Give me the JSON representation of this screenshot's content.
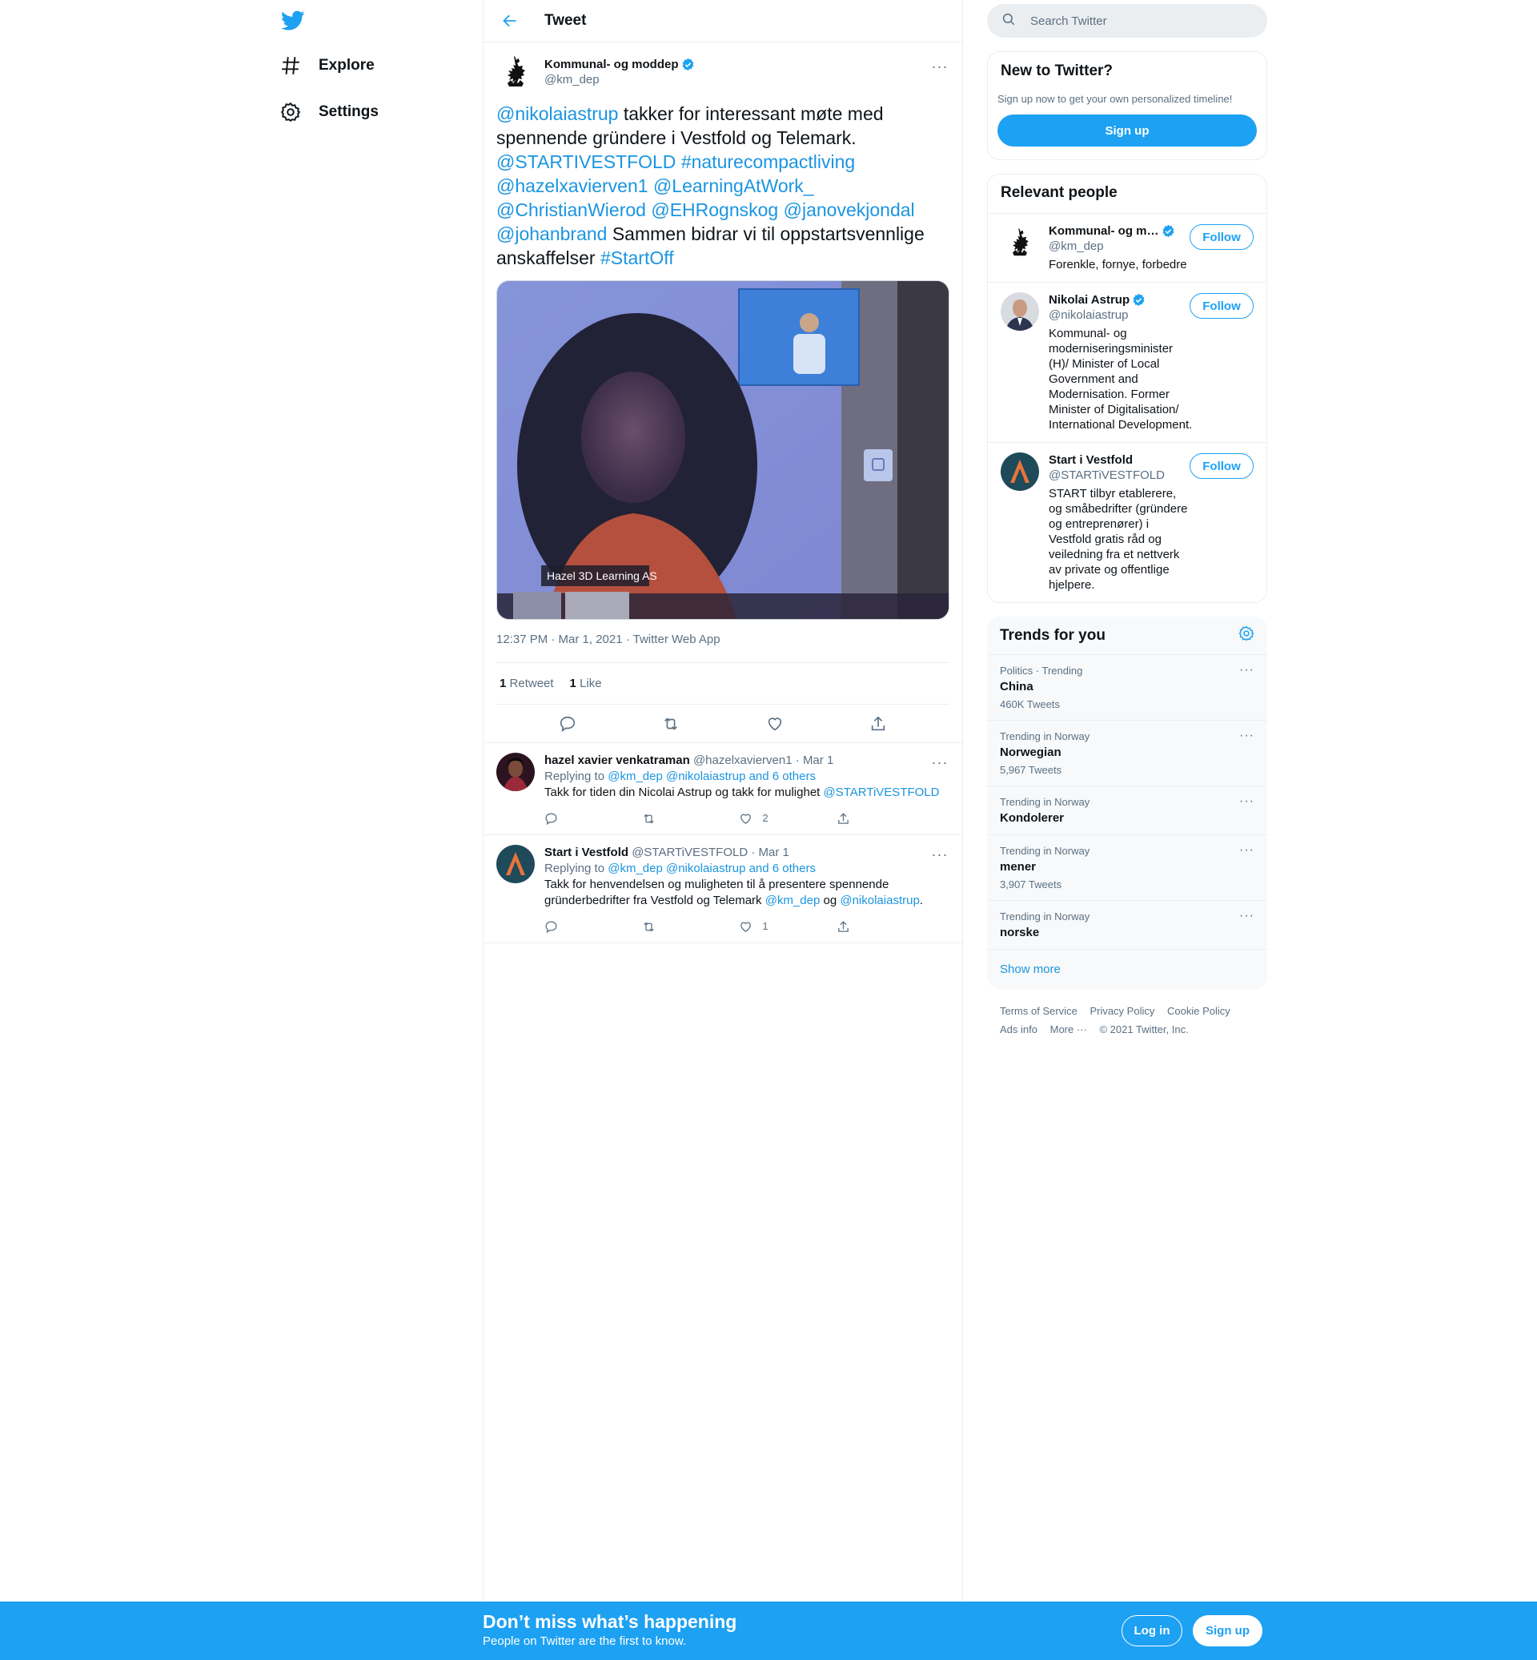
{
  "nav": {
    "explore_label": "Explore",
    "settings_label": "Settings"
  },
  "header": {
    "title": "Tweet"
  },
  "tweet": {
    "display_name": "Kommunal- og moddep",
    "handle": "@km_dep",
    "text_parts": [
      {
        "t": "@nikolaiastrup",
        "link": true
      },
      {
        "t": " takker for interessant møte med spennende gründere i Vestfold og Telemark. ",
        "link": false
      },
      {
        "t": "@STARTIVESTFOLD",
        "link": true
      },
      {
        "t": "  ",
        "link": false
      },
      {
        "t": "#naturecompactliving",
        "link": true
      },
      {
        "t": " ",
        "link": false
      },
      {
        "t": "@hazelxavierven1",
        "link": true
      },
      {
        "t": " ",
        "link": false
      },
      {
        "t": "@LearningAtWork_",
        "link": true
      },
      {
        "t": " ",
        "link": false
      },
      {
        "t": "@ChristianWierod",
        "link": true
      },
      {
        "t": " ",
        "link": false
      },
      {
        "t": "@EHRognskog",
        "link": true
      },
      {
        "t": " ",
        "link": false
      },
      {
        "t": "@janovekjondal",
        "link": true
      },
      {
        "t": " ",
        "link": false
      },
      {
        "t": "@johanbrand",
        "link": true
      },
      {
        "t": " Sammen bidrar vi til oppstartsvennlige anskaffelser ",
        "link": false
      },
      {
        "t": "#StartOff",
        "link": true
      }
    ],
    "media_caption": "Hazel 3D Learning AS",
    "timestamp": "12:37 PM · Mar 1, 2021 · Twitter Web App",
    "retweets_count": "1",
    "retweets_label": "Retweet",
    "likes_count": "1",
    "likes_label": "Like"
  },
  "replies": [
    {
      "name": "hazel xavier venkatraman",
      "handle": "@hazelxavierven1",
      "date": "Mar 1",
      "replying_prefix": "Replying to ",
      "replying_to": "@km_dep @nikolaiastrup and 6 others",
      "text": "Takk for tiden din Nicolai Astrup og takk for mulighet ",
      "text_link": "@STARTiVESTFOLD",
      "likes": "2"
    },
    {
      "name": "Start i Vestfold",
      "handle": "@STARTiVESTFOLD",
      "date": "Mar 1",
      "replying_prefix": "Replying to ",
      "replying_to": "@km_dep @nikolaiastrup and 6 others",
      "text": "Takk for henvendelsen og muligheten til å presentere spennende gründerbedrifter fra Vestfold og Telemark  ",
      "link1": "@km_dep",
      "mid": " og ",
      "link2": "@nikolaiastrup",
      "end": ".",
      "likes": "1"
    }
  ],
  "search": {
    "placeholder": "Search Twitter"
  },
  "new_to_twitter": {
    "title": "New to Twitter?",
    "text": "Sign up now to get your own personalized timeline!",
    "button": "Sign up"
  },
  "relevant_people": {
    "title": "Relevant people",
    "follow_label": "Follow",
    "people": [
      {
        "name": "Kommunal- og m…",
        "handle": "@km_dep",
        "bio": "Forenkle, fornye, forbedre"
      },
      {
        "name": "Nikolai Astrup",
        "handle": "@nikolaiastrup",
        "bio": "Kommunal- og moderniseringsminister (H)/ Minister of Local Government and Modernisation. Former Minister of Digitalisation/ International Development."
      },
      {
        "name": "Start i Vestfold",
        "handle": "@STARTiVESTFOLD",
        "bio": "START tilbyr etablerere, og småbedrifter (gründere og entreprenører) i Vestfold gratis råd og veiledning fra et nettverk av private og offentlige hjelpere."
      }
    ]
  },
  "trends": {
    "title": "Trends for you",
    "items": [
      {
        "context": "Politics · Trending",
        "name": "China",
        "count": "460K Tweets"
      },
      {
        "context": "Trending in Norway",
        "name": "Norwegian",
        "count": "5,967 Tweets"
      },
      {
        "context": "Trending in Norway",
        "name": "Kondolerer",
        "count": ""
      },
      {
        "context": "Trending in Norway",
        "name": "mener",
        "count": "3,907 Tweets"
      },
      {
        "context": "Trending in Norway",
        "name": "norske",
        "count": ""
      }
    ],
    "show_more": "Show more"
  },
  "footer": {
    "terms": "Terms of Service",
    "privacy": "Privacy Policy",
    "cookie": "Cookie Policy",
    "ads": "Ads info",
    "more": "More ···",
    "copyright": "© 2021 Twitter, Inc."
  },
  "bottom_bar": {
    "title": "Don’t miss what’s happening",
    "subtitle": "People on Twitter are the first to know.",
    "login": "Log in",
    "signup": "Sign up"
  },
  "colors": {
    "accent": "#1da1f2",
    "link": "#1b95e0",
    "muted": "#5b7083"
  }
}
